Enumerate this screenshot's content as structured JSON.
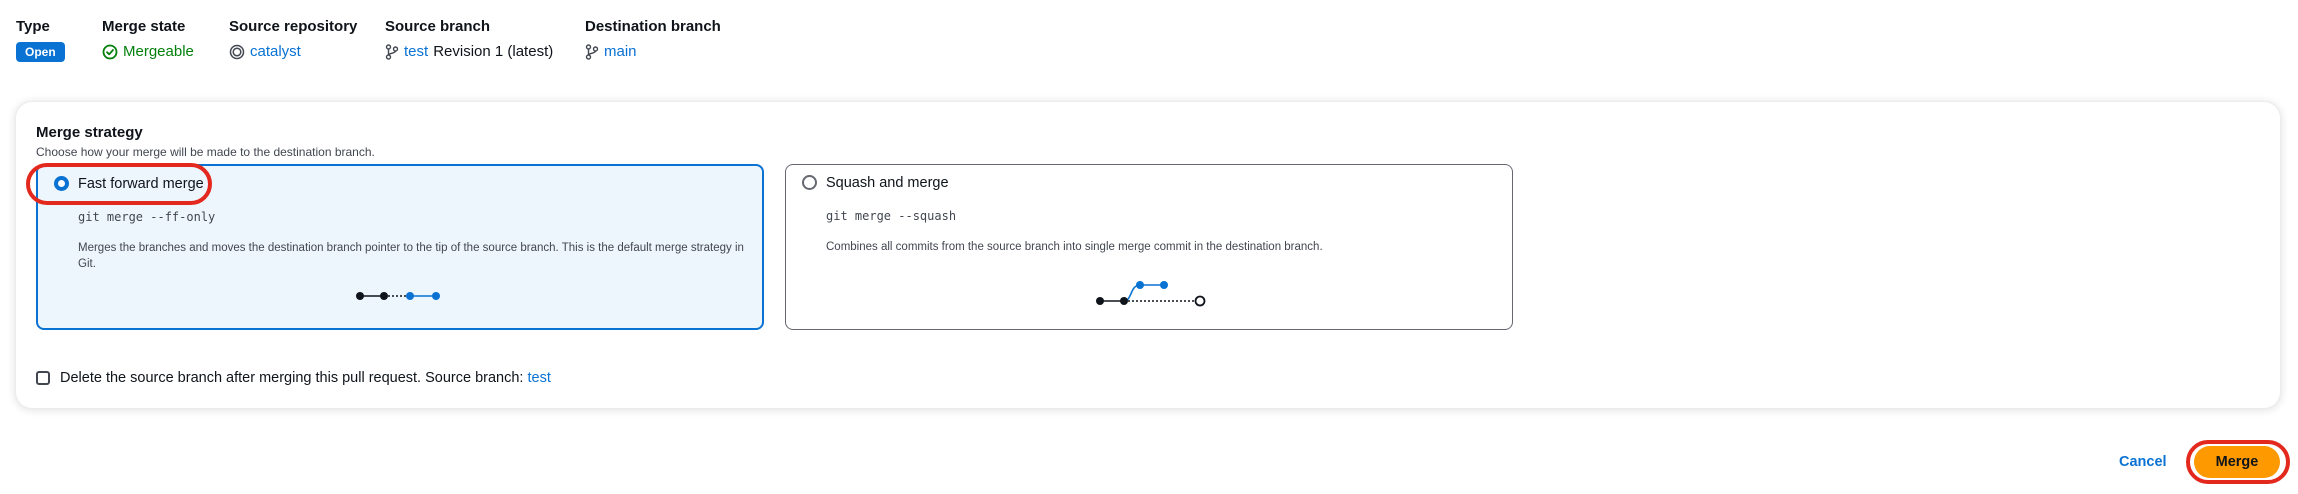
{
  "summary": {
    "type_label": "Type",
    "type_value": "Open",
    "merge_state_label": "Merge state",
    "merge_state_value": "Mergeable",
    "source_repo_label": "Source repository",
    "source_repo_value": "catalyst",
    "source_branch_label": "Source branch",
    "source_branch_value": "test",
    "source_branch_revision": "Revision 1 (latest)",
    "dest_branch_label": "Destination branch",
    "dest_branch_value": "main"
  },
  "strategy": {
    "title": "Merge strategy",
    "description": "Choose how your merge will be made to the destination branch.",
    "options": [
      {
        "label": "Fast forward merge",
        "command": "git merge --ff-only",
        "description": "Merges the branches and moves the destination branch pointer to the tip of the source branch. This is the default merge strategy in Git.",
        "selected": true
      },
      {
        "label": "Squash and merge",
        "command": "git merge --squash",
        "description": "Combines all commits from the source branch into single merge commit in the destination branch.",
        "selected": false
      }
    ],
    "delete_branch_label": "Delete the source branch after merging this pull request. Source branch:",
    "delete_branch_link": "test"
  },
  "actions": {
    "cancel_label": "Cancel",
    "merge_label": "Merge"
  },
  "colors": {
    "accent": "#0972d3",
    "success": "#037f0c",
    "primary_button": "#ff9900",
    "highlight": "#e3291d"
  },
  "icons": [
    "check-circle-icon",
    "repository-icon",
    "branch-icon"
  ]
}
